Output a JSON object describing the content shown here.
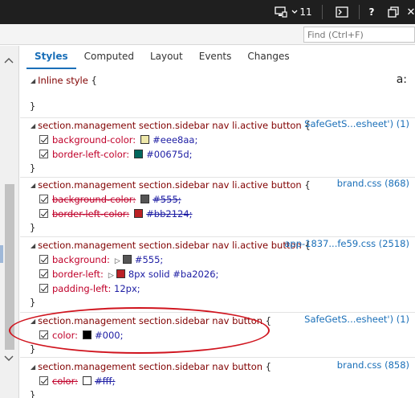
{
  "topbar": {
    "screen_icon": "monitor-icon",
    "count": "11",
    "console_icon": "console-icon",
    "help": "?",
    "undock_icon": "undock-icon",
    "close": "✕"
  },
  "search": {
    "placeholder": "Find (Ctrl+F)"
  },
  "tabs": [
    {
      "label": "Styles",
      "active": true
    },
    {
      "label": "Computed"
    },
    {
      "label": "Layout"
    },
    {
      "label": "Events"
    },
    {
      "label": "Changes"
    }
  ],
  "inline": {
    "label": "Inline style",
    "open": "{",
    "close": "}",
    "icon_label": "a:"
  },
  "rules": [
    {
      "selector": "section.management section.sidebar nav li.active button",
      "source": "SafeGetS...esheet') (1)",
      "props": [
        {
          "name": "background-color:",
          "value": "#eee8aa;",
          "swatch": "#eee8aa",
          "struck": false
        },
        {
          "name": "border-left-color:",
          "value": "#00675d;",
          "swatch": "#00675d",
          "struck": false
        }
      ]
    },
    {
      "selector": "section.management section.sidebar nav li.active button",
      "source": "brand.css (868)",
      "props": [
        {
          "name": "background-color:",
          "value": "#555;",
          "swatch": "#555555",
          "struck": true
        },
        {
          "name": "border-left-color:",
          "value": "#bb2124;",
          "swatch": "#bb2124",
          "struck": true
        }
      ]
    },
    {
      "selector": "section.management section.sidebar nav li.active button",
      "source": "app-1837...fe59.css (2518)",
      "props": [
        {
          "name": "background:",
          "value": "#555;",
          "swatch": "#555555",
          "expand": true,
          "struck": false
        },
        {
          "name": "border-left:",
          "value": "8px solid #ba2026;",
          "swatch": "#ba2026",
          "expand": true,
          "struck": false
        },
        {
          "name": "padding-left:",
          "value": "12px;",
          "struck": false
        }
      ]
    },
    {
      "selector": "section.management section.sidebar nav button",
      "source": "SafeGetS...esheet') (1)",
      "props": [
        {
          "name": "color:",
          "value": "#000;",
          "swatch": "#000000",
          "struck": false
        }
      ]
    },
    {
      "selector": "section.management section.sidebar nav button",
      "source": "brand.css (858)",
      "props": [
        {
          "name": "color:",
          "value": "#fff;",
          "swatch": "#ffffff",
          "struck": true
        }
      ]
    }
  ],
  "brace_open": "{",
  "brace_close": "}"
}
